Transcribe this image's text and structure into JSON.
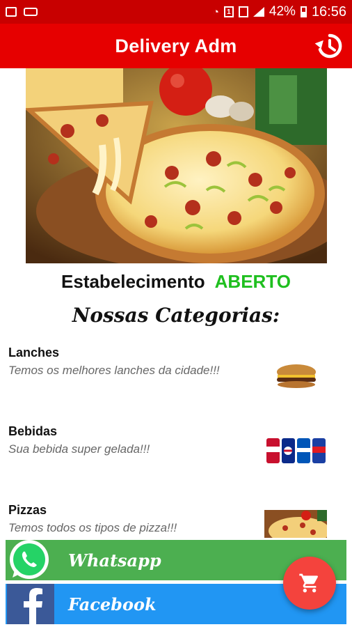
{
  "status_bar": {
    "battery": "42%",
    "time": "16:56",
    "notification_badge": "1"
  },
  "app_bar": {
    "title": "Delivery Adm",
    "history_icon": "history-icon"
  },
  "establishment": {
    "label": "Estabelecimento",
    "status": "ABERTO",
    "status_color": "#1fbf1f"
  },
  "categories_title": "Nossas Categorias:",
  "categories": [
    {
      "name": "Lanches",
      "description": "Temos os melhores lanches da cidade!!!",
      "icon": "burger-icon"
    },
    {
      "name": "Bebidas",
      "description": "Sua bebida super gelada!!!",
      "icon": "soda-cans-icon"
    },
    {
      "name": "Pizzas",
      "description": "Temos todos os tipos de pizza!!!",
      "icon": "pizza-icon"
    }
  ],
  "buttons": {
    "whatsapp": "Whatsapp",
    "facebook": "Facebook"
  },
  "colors": {
    "primary": "#e60000",
    "status_bar": "#c80000",
    "whatsapp": "#4caf50",
    "facebook": "#2196f3",
    "fab": "#f4433d"
  }
}
